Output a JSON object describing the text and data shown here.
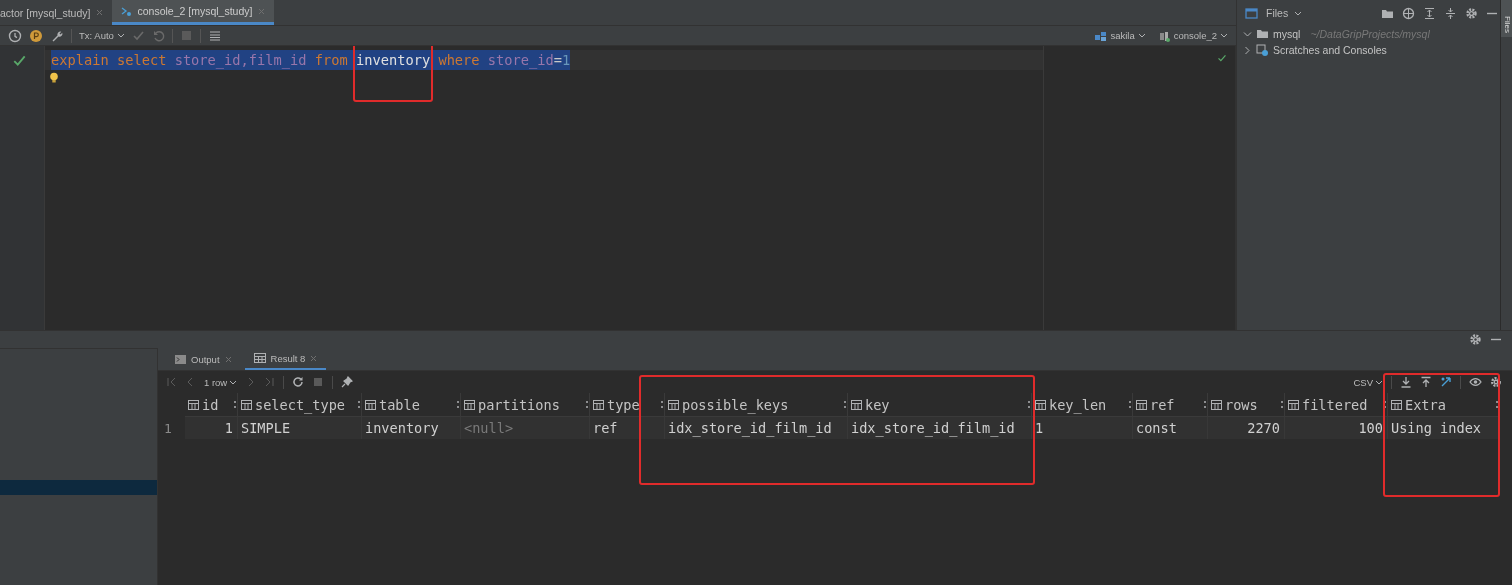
{
  "editor_tabs": [
    {
      "label": "actor [mysql_study]",
      "selected": false
    },
    {
      "label": "console_2 [mysql_study]",
      "selected": true
    }
  ],
  "toolbar": {
    "transaction_mode": "Tx: Auto",
    "data_source": "sakila",
    "session": "console_2"
  },
  "editor": {
    "words": [
      {
        "boxed": false,
        "parts": [
          {
            "text": "explain",
            "kind": "keyword"
          }
        ]
      },
      {
        "boxed": false,
        "parts": [
          {
            "text": "select",
            "kind": "keyword"
          }
        ]
      },
      {
        "boxed": false,
        "parts": [
          {
            "text": "store_id,film_id",
            "kind": "column"
          }
        ]
      },
      {
        "boxed": false,
        "parts": [
          {
            "text": "from",
            "kind": "keyword"
          }
        ]
      },
      {
        "boxed": true,
        "parts": [
          {
            "text": "inventory",
            "kind": "table"
          }
        ]
      },
      {
        "boxed": false,
        "parts": [
          {
            "text": "where",
            "kind": "keyword"
          }
        ]
      },
      {
        "boxed": false,
        "parts": [
          {
            "text": "store_id",
            "kind": "column"
          },
          {
            "text": "=",
            "kind": "operator"
          },
          {
            "text": "1",
            "kind": "number"
          }
        ]
      }
    ]
  },
  "project_panel": {
    "title": "Files",
    "tree": [
      {
        "label": "mysql",
        "path": "~/DataGripProjects/mysql",
        "expanded": true
      },
      {
        "label": "Scratches and Consoles",
        "expanded": false
      }
    ]
  },
  "side_stripe": {
    "label": "Files"
  },
  "services_tree": {
    "rows": [
      {
        "selected": false
      },
      {
        "selected": false
      },
      {
        "selected": false
      },
      {
        "selected": false
      },
      {
        "selected": false
      },
      {
        "selected": false
      },
      {
        "selected": false
      },
      {
        "selected": true
      }
    ]
  },
  "results": {
    "tabs": [
      {
        "label": "Output",
        "selected": false
      },
      {
        "label": "Result 8",
        "selected": true
      }
    ],
    "row_count": "1 row",
    "export_format": "CSV",
    "columns": [
      {
        "name": "id",
        "boxed": false
      },
      {
        "name": "select_type",
        "boxed": false
      },
      {
        "name": "table",
        "boxed": false
      },
      {
        "name": "partitions",
        "boxed": false
      },
      {
        "name": "type",
        "boxed": false
      },
      {
        "name": "possible_keys",
        "boxed": true
      },
      {
        "name": "key",
        "boxed": true
      },
      {
        "name": "key_len",
        "boxed": false
      },
      {
        "name": "ref",
        "boxed": false
      },
      {
        "name": "rows",
        "boxed": false
      },
      {
        "name": "filtered",
        "boxed": false
      },
      {
        "name": "Extra",
        "boxed": true
      }
    ],
    "rows": [
      {
        "number": "1",
        "cells": [
          {
            "text": "1",
            "kind": "number"
          },
          {
            "text": "SIMPLE",
            "kind": "text"
          },
          {
            "text": "inventory",
            "kind": "text"
          },
          {
            "text": "<null>",
            "kind": "null"
          },
          {
            "text": "ref",
            "kind": "text"
          },
          {
            "text": "idx_store_id_film_id",
            "kind": "text"
          },
          {
            "text": "idx_store_id_film_id",
            "kind": "text"
          },
          {
            "text": "1",
            "kind": "text"
          },
          {
            "text": "const",
            "kind": "text"
          },
          {
            "text": "2270",
            "kind": "number"
          },
          {
            "text": "100",
            "kind": "number"
          },
          {
            "text": "Using index",
            "kind": "text"
          }
        ]
      }
    ]
  }
}
